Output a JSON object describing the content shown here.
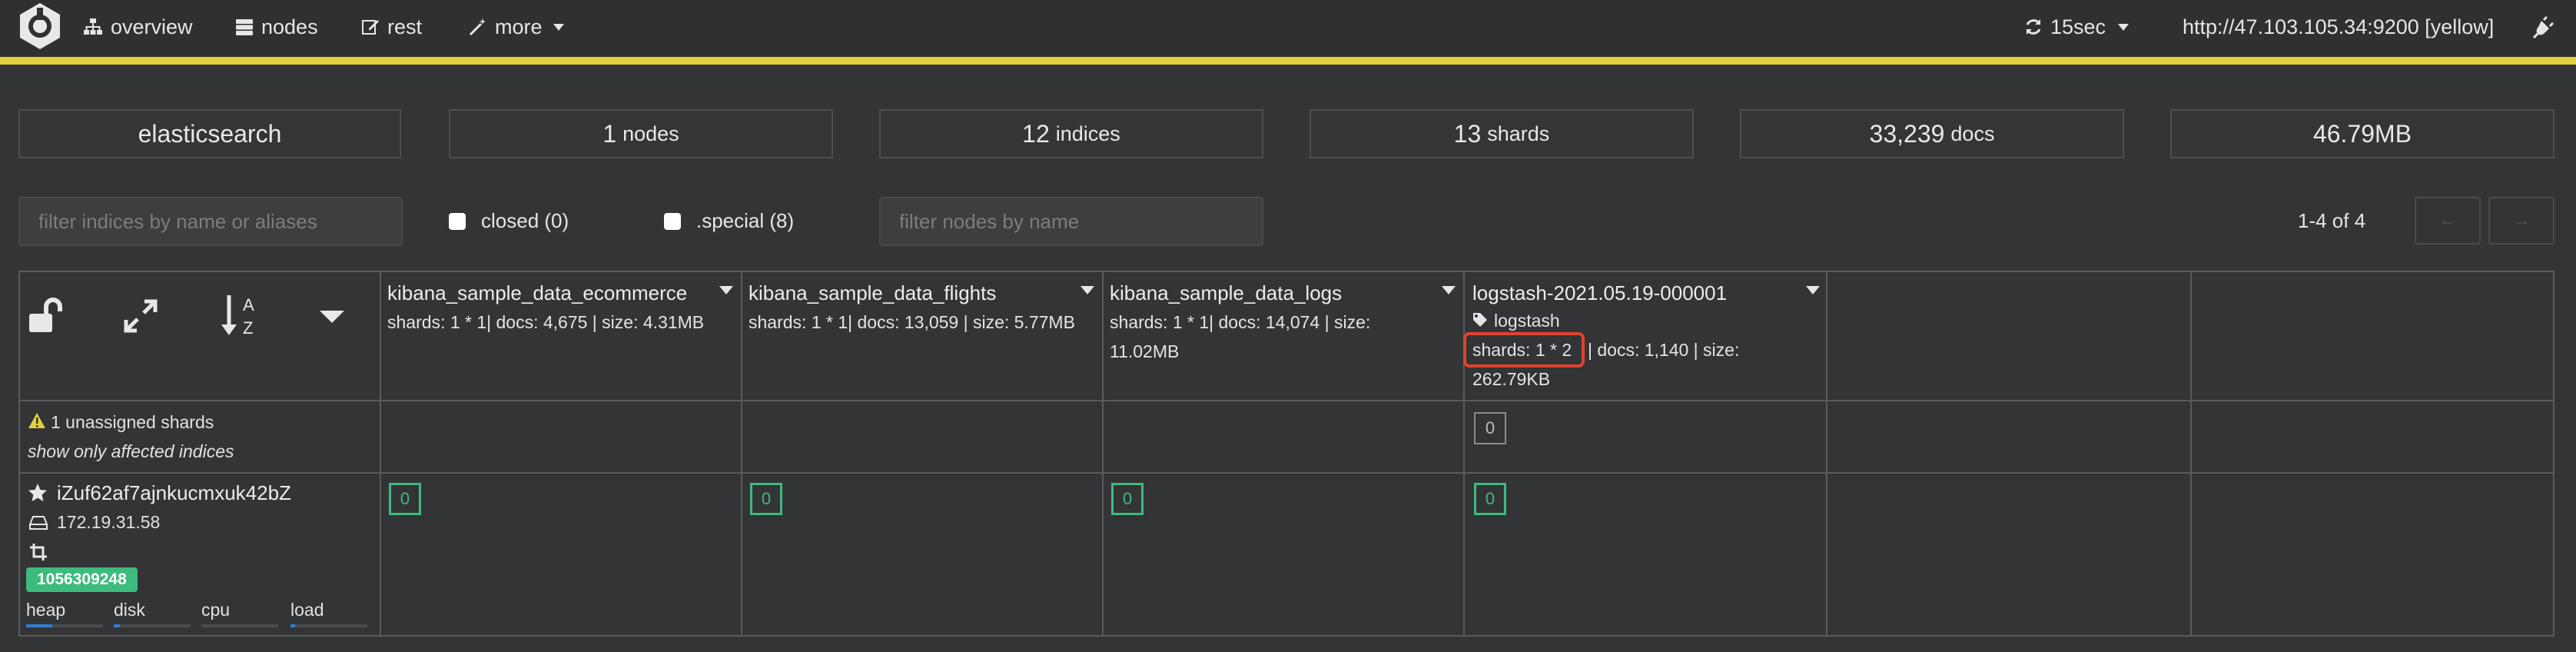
{
  "nav": {
    "overview": "overview",
    "nodes": "nodes",
    "rest": "rest",
    "more": "more",
    "refresh": "15sec",
    "cluster_url": "http://47.103.105.34:9200 [yellow]"
  },
  "stats": {
    "cluster_name": "elasticsearch",
    "nodes_value": "1",
    "nodes_label": "nodes",
    "indices_value": "12",
    "indices_label": "indices",
    "shards_value": "13",
    "shards_label": "shards",
    "docs_value": "33,239",
    "docs_label": "docs",
    "size": "46.79MB"
  },
  "filters": {
    "indices_placeholder": "filter indices by name or aliases",
    "closed_label": "closed (0)",
    "special_label": ".special (8)",
    "nodes_placeholder": "filter nodes by name",
    "pager_text": "1-4 of 4",
    "prev": "←",
    "next": "→"
  },
  "indices": [
    {
      "name": "kibana_sample_data_ecommerce",
      "info1": "shards: 1 * 1| docs: 4,675 | size: 4.31MB",
      "info2": "",
      "shard": "0"
    },
    {
      "name": "kibana_sample_data_flights",
      "info1": "shards: 1 * 1| docs: 13,059 | size: 5.77MB",
      "info2": "",
      "shard": "0"
    },
    {
      "name": "kibana_sample_data_logs",
      "info1": "shards: 1 * 1| docs: 14,074 | size:",
      "info2": "11.02MB",
      "shard": "0"
    },
    {
      "name": "logstash-2021.05.19-000001",
      "alias": "logstash",
      "shards_part": "shards: 1 * 2",
      "info1_rest": "| docs: 1,140 | size:",
      "info2": "262.79KB",
      "shard": "0",
      "unassigned_shard": "0"
    }
  ],
  "unassigned": {
    "label": "1 unassigned shards",
    "link": "show only affected indices"
  },
  "node": {
    "name": "iZuf62af7ajnkucmxuk42bZ",
    "ip": "172.19.31.58",
    "badge": "1056309248",
    "metrics": [
      "heap",
      "disk",
      "cpu",
      "load"
    ]
  },
  "colors": {
    "background": "#333436",
    "health_yellow": "#e2cf3c",
    "shard_green": "#3dbb7c",
    "highlight_red": "#e0432e"
  }
}
